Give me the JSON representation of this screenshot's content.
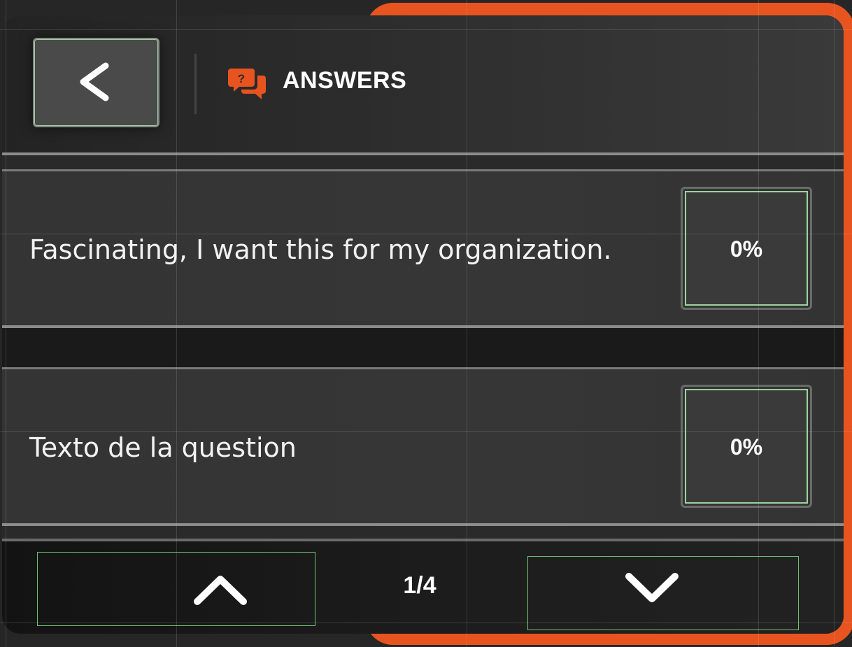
{
  "header": {
    "back_icon": "chevron-left-icon",
    "section_icon": "question-bubbles-icon",
    "title": "ANSWERS"
  },
  "answers": [
    {
      "text": "Fascinating, I want this for my organization.",
      "percent": "0%"
    },
    {
      "text": "Texto de la question",
      "percent": "0%"
    }
  ],
  "pagination": {
    "prev_icon": "chevron-up-icon",
    "next_icon": "chevron-down-icon",
    "page": "1/4"
  },
  "colors": {
    "accent": "#e8541f",
    "panel": "#2f2f2f",
    "highlight_outline": "#9ad49c"
  }
}
